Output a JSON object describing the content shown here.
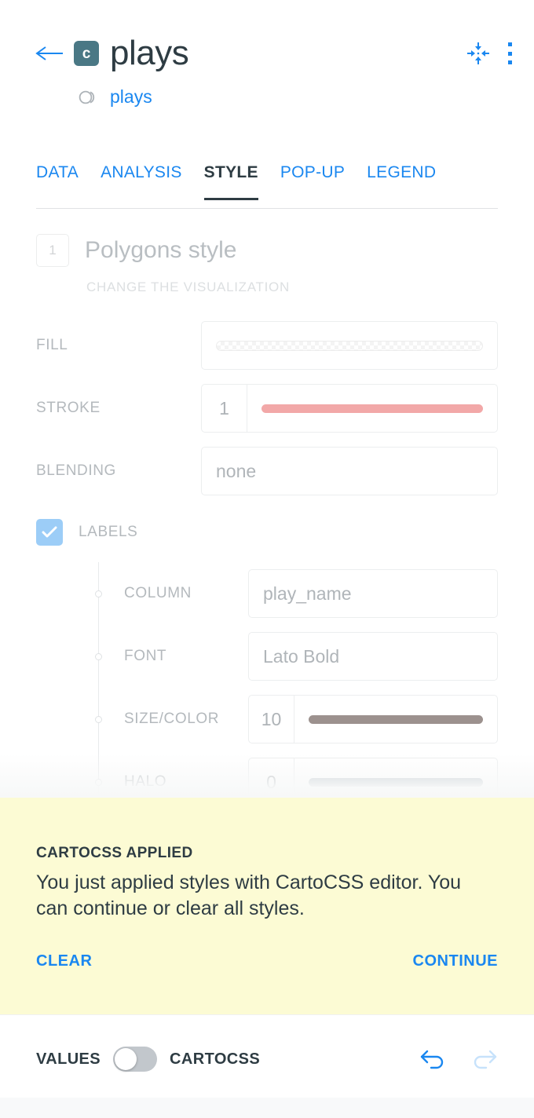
{
  "header": {
    "back_icon": "arrow-left-icon",
    "logo_letter": "c",
    "title": "plays",
    "dataset_icon": "dataset-icon",
    "dataset_name": "plays",
    "fit_icon": "zoom-to-fit-icon",
    "menu_icon": "kebab-menu-icon"
  },
  "tabs": [
    {
      "label": "DATA",
      "active": false
    },
    {
      "label": "ANALYSIS",
      "active": false
    },
    {
      "label": "STYLE",
      "active": true
    },
    {
      "label": "POP-UP",
      "active": false
    },
    {
      "label": "LEGEND",
      "active": false
    }
  ],
  "section": {
    "step": "1",
    "title": "Polygons style",
    "subtitle": "CHANGE THE VISUALIZATION"
  },
  "properties": {
    "fill": {
      "label": "FILL",
      "color": "transparent"
    },
    "stroke": {
      "label": "STROKE",
      "value": "1",
      "color": "#f2a8a8"
    },
    "blending": {
      "label": "BLENDING",
      "value": "none"
    },
    "labels": {
      "label": "LABELS",
      "checked": true
    },
    "column": {
      "label": "COLUMN",
      "value": "play_name"
    },
    "font": {
      "label": "FONT",
      "value": "Lato Bold"
    },
    "size_color": {
      "label": "SIZE/COLOR",
      "value": "10",
      "color": "#9c918e"
    },
    "halo": {
      "label": "HALO",
      "value": "0",
      "color": "#bcc5cc"
    }
  },
  "banner": {
    "title": "CARTOCSS APPLIED",
    "body": "You just applied styles with CartoCSS editor. You can continue or clear all styles.",
    "clear_label": "CLEAR",
    "continue_label": "CONTINUE",
    "background": "#fcfbd4",
    "link_color": "#1a87f0"
  },
  "footer": {
    "values_label": "VALUES",
    "cartocss_label": "CARTOCSS",
    "toggle_state": "values",
    "undo_icon": "undo-arrow-icon",
    "redo_icon": "redo-arrow-icon",
    "undo_enabled": true,
    "redo_enabled": false
  },
  "colors": {
    "accent": "#1a87f0",
    "text_dark": "#2e3c43",
    "muted": "#b4b9bd",
    "logo_bg": "#4a7885"
  }
}
